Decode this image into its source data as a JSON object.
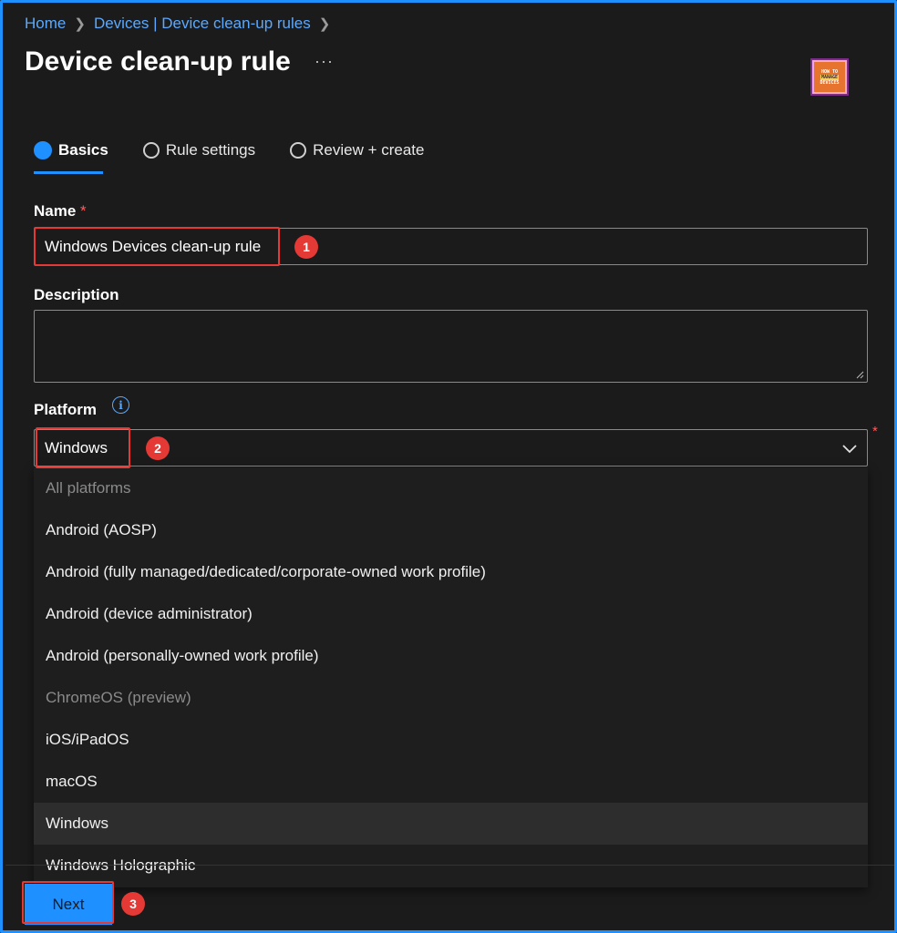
{
  "breadcrumb": {
    "items": [
      "Home",
      "Devices | Device clean-up rules"
    ]
  },
  "header": {
    "title": "Device clean-up rule",
    "more_label": "···",
    "logo": [
      "HOW TO",
      "MANAGE",
      "DEVICES"
    ]
  },
  "tabs": [
    {
      "label": "Basics",
      "state": "active"
    },
    {
      "label": "Rule settings",
      "state": "inactive"
    },
    {
      "label": "Review + create",
      "state": "inactive"
    }
  ],
  "form": {
    "name_label": "Name",
    "required_mark": "*",
    "name_value": "Windows Devices clean-up rule",
    "description_label": "Description",
    "description_value": "",
    "platform_label": "Platform",
    "platform_value": "Windows"
  },
  "platform_options": [
    {
      "label": "All platforms",
      "disabled": true
    },
    {
      "label": "Android (AOSP)",
      "disabled": false
    },
    {
      "label": "Android (fully managed/dedicated/corporate-owned work profile)",
      "disabled": false
    },
    {
      "label": "Android (device administrator)",
      "disabled": false
    },
    {
      "label": "Android (personally-owned work profile)",
      "disabled": false
    },
    {
      "label": "ChromeOS (preview)",
      "disabled": true
    },
    {
      "label": "iOS/iPadOS",
      "disabled": false
    },
    {
      "label": "macOS",
      "disabled": false
    },
    {
      "label": "Windows",
      "disabled": false,
      "selected": true
    },
    {
      "label": "Windows Holographic",
      "disabled": false
    }
  ],
  "footer": {
    "next_label": "Next"
  },
  "annotations": [
    "1",
    "2",
    "3"
  ],
  "colors": {
    "accent": "#1e90ff",
    "highlight": "#e53935",
    "background": "#1b1b1b"
  }
}
